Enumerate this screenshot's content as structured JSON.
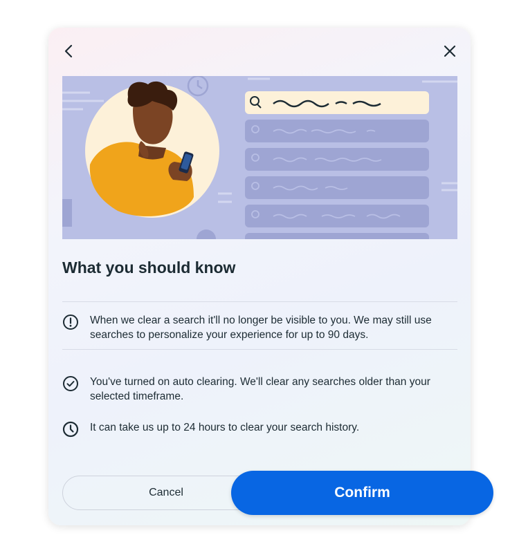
{
  "dialog": {
    "title": "What you should know",
    "items": [
      {
        "icon": "alert-circle-icon",
        "text": "When we clear a search it'll no longer be visible to you. We may still use searches to personalize your experience for up to 90 days."
      },
      {
        "icon": "check-circle-icon",
        "text": "You've turned on auto clearing. We'll clear any searches older than your selected timeframe."
      },
      {
        "icon": "clock-icon",
        "text": "It can take us up to 24 hours to clear your search history."
      }
    ],
    "cancel_label": "Cancel",
    "confirm_label": "Confirm"
  },
  "colors": {
    "primary": "#0866e3",
    "banner_bg": "#b9bfe5",
    "highlight_row": "#fdf1d9",
    "text": "#1c2b33"
  }
}
